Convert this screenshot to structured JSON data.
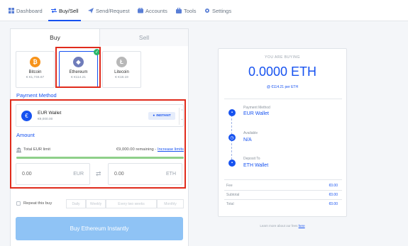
{
  "nav": {
    "items": [
      {
        "label": "Dashboard",
        "icon": "dashboard-icon"
      },
      {
        "label": "Buy/Sell",
        "icon": "swap-icon",
        "active": true
      },
      {
        "label": "Send/Request",
        "icon": "send-icon"
      },
      {
        "label": "Accounts",
        "icon": "accounts-icon"
      },
      {
        "label": "Tools",
        "icon": "tools-icon"
      },
      {
        "label": "Settings",
        "icon": "gear-icon"
      }
    ]
  },
  "tabs": {
    "buy": "Buy",
    "sell": "Sell"
  },
  "coins": [
    {
      "name": "Bitcoin",
      "price": "€ €1,746.67",
      "symbol": "₿",
      "color": "#f7931a"
    },
    {
      "name": "Ethereum",
      "price": "€ €114.21",
      "symbol": "◆",
      "color": "#6f7cba",
      "selected": true
    },
    {
      "name": "Litecoin",
      "price": "€ €18.19",
      "symbol": "Ł",
      "color": "#b8b8b8"
    }
  ],
  "payment": {
    "section_label": "Payment Method",
    "name": "EUR Wallet",
    "balance": "€9,000.00",
    "badge": "INSTANT",
    "icon_symbol": "€"
  },
  "amount": {
    "section_label": "Amount",
    "limit_label": "Total EUR limit",
    "remaining": "€9,000.00 remaining -",
    "increase_link": "Increase limits",
    "limit_used_fraction": 0.0,
    "eur_value": "0.00",
    "eur_currency": "EUR",
    "eth_value": "0.00",
    "eth_currency": "ETH",
    "swap_glyph": "⇄"
  },
  "repeat": {
    "label": "Repeat this buy",
    "options": [
      "Daily",
      "Weekly",
      "Every two weeks",
      "Monthly"
    ]
  },
  "buy_button": "Buy Ethereum Instantly",
  "summary": {
    "heading": "YOU ARE BUYING",
    "amount": "0.0000 ETH",
    "rate": "@ €114.21 per ETH",
    "steps": [
      {
        "label": "Payment Method",
        "value": "EUR Wallet",
        "icon": "wallet-icon"
      },
      {
        "label": "Available",
        "value": "N/A",
        "icon": "clock-icon"
      },
      {
        "label": "Deposit To",
        "value": "ETH Wallet",
        "icon": "wallet-icon"
      }
    ],
    "rows": [
      {
        "label": "Fee",
        "value": "€0.00"
      },
      {
        "label": "Subtotal",
        "value": "€0.00"
      },
      {
        "label": "Total",
        "value": "€0.00"
      }
    ]
  },
  "learn_more": {
    "text": "Learn more about our fees",
    "link": "here"
  },
  "colors": {
    "accent": "#1652f0",
    "highlight": "#e02b1c",
    "success": "#2bb66a"
  }
}
